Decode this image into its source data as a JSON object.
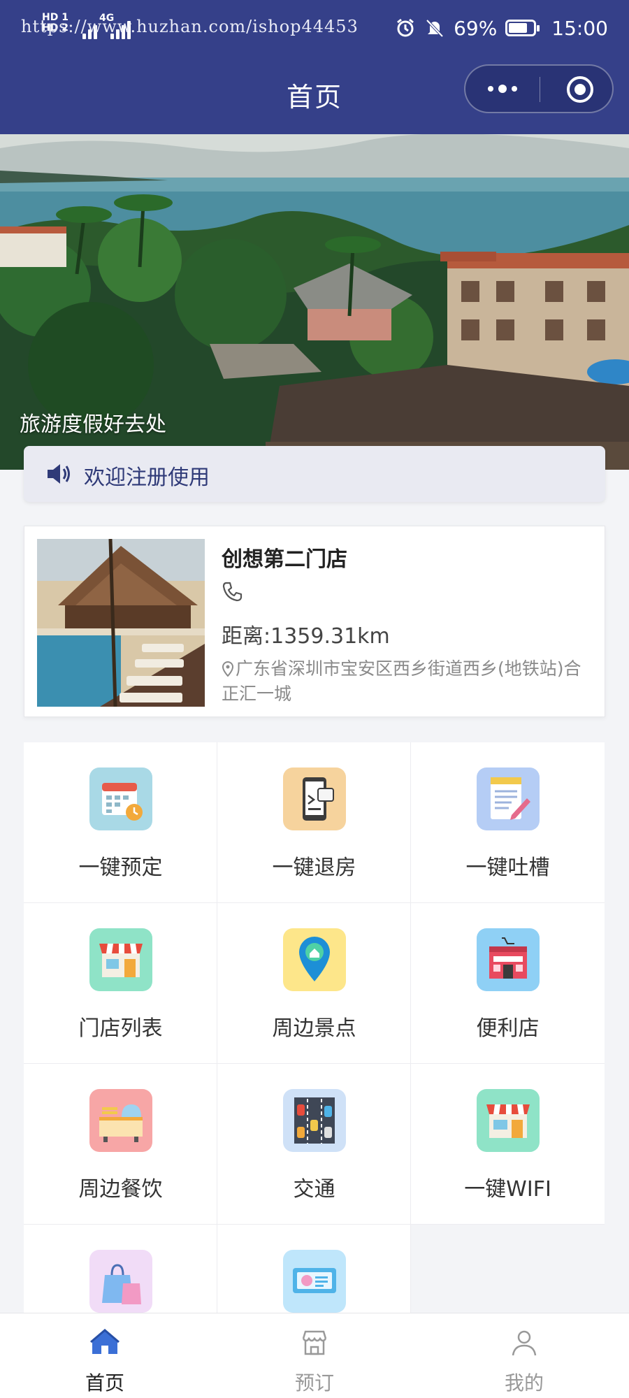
{
  "status_bar": {
    "url_overlay": "https://www.huzhan.com/ishop44453",
    "signal_labels": [
      "HD 1",
      "HD 2"
    ],
    "network_labels": [
      "4G",
      "4G"
    ],
    "battery": "69%",
    "time": "15:00"
  },
  "nav": {
    "title": "首页"
  },
  "banner": {
    "caption": "旅游度假好去处"
  },
  "notice": {
    "text": "欢迎注册使用"
  },
  "store": {
    "name": "创想第二门店",
    "distance": "距离:1359.31km",
    "address": "广东省深圳市宝安区西乡街道西乡(地铁站)合正汇一城"
  },
  "grid": {
    "items": [
      {
        "label": "一键预定",
        "icon": "calendar-icon"
      },
      {
        "label": "一键退房",
        "icon": "phone-checkout-icon"
      },
      {
        "label": "一键吐槽",
        "icon": "notepad-icon"
      },
      {
        "label": "门店列表",
        "icon": "storefront-icon"
      },
      {
        "label": "周边景点",
        "icon": "map-pin-icon"
      },
      {
        "label": "便利店",
        "icon": "convenience-store-icon"
      },
      {
        "label": "周边餐饮",
        "icon": "food-cart-icon"
      },
      {
        "label": "交通",
        "icon": "traffic-icon"
      },
      {
        "label": "一键WIFI",
        "icon": "wifi-shop-icon"
      },
      {
        "label": "",
        "icon": "shopping-bag-icon"
      },
      {
        "label": "",
        "icon": "ticket-icon"
      }
    ]
  },
  "tabbar": {
    "tabs": [
      {
        "label": "首页",
        "icon": "home-icon",
        "active": true
      },
      {
        "label": "预订",
        "icon": "store-icon",
        "active": false
      },
      {
        "label": "我的",
        "icon": "user-icon",
        "active": false
      }
    ]
  },
  "colors": {
    "nav_bg": "#354089",
    "accent_blue": "#3b6fd6",
    "notice_text": "#2f3a78"
  }
}
